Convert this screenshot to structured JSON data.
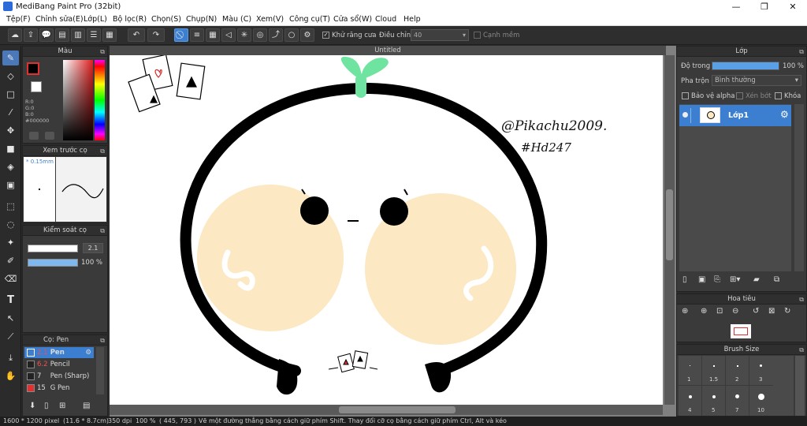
{
  "window": {
    "title": "MediBang Paint Pro (32bit)",
    "minimize": "—",
    "restore": "❐",
    "close": "✕"
  },
  "menu": [
    "Tệp(F)",
    "Chỉnh sửa(E)",
    "Lớp(L)",
    "Bộ lọc(R)",
    "Chọn(S)",
    "Chụp(N)",
    "Màu (C)",
    "Xem(V)",
    "Công cụ(T)",
    "Cửa sổ(W)",
    "Cloud",
    "Help"
  ],
  "toolbar": {
    "antialias_label": "Khử răng cưa",
    "adjust_label": "Điều chỉnh",
    "adjust_value": "40",
    "edge_label": "Cạnh mềm"
  },
  "document": {
    "tab_title": "Untitled",
    "signature_line1": "@Pikachu2009.",
    "signature_line2": "#Hd247"
  },
  "color_panel": {
    "title": "Màu",
    "r": "R:0",
    "g": "G:0",
    "b": "B:0",
    "hex": "#000000",
    "current_color": "#000000"
  },
  "preview_panel": {
    "title": "Xem trước cọ",
    "size": "* 0.15mm"
  },
  "brush_control": {
    "title": "Kiểm soát cọ",
    "size_value": "2.1",
    "opacity_value": "100 %",
    "opacity_level": 1.0
  },
  "brush_list": {
    "title": "Cọ: Pen",
    "items": [
      {
        "num": "2.1",
        "name": "Pen",
        "color": "#ffffff",
        "selected": true
      },
      {
        "num": "6.2",
        "name": "Pencil",
        "color": "#222222",
        "selected": false
      },
      {
        "num": "7",
        "name": "Pen (Sharp)",
        "color": "#222222",
        "selected": false
      },
      {
        "num": "15",
        "name": "G Pen",
        "color": "#e03030",
        "selected": false
      }
    ]
  },
  "layer_panel": {
    "title": "Lớp",
    "opacity_label": "Độ trong",
    "opacity_value": "100 %",
    "opacity_level": 1.0,
    "blend_label": "Pha trộn",
    "blend_value": "Bình thường",
    "alpha_protect": "Bảo vệ alpha",
    "clipping": "Xén bớt",
    "lock": "Khóa",
    "layers": [
      {
        "name": "Lớp1"
      }
    ]
  },
  "navigator": {
    "title": "Hoa tiêu"
  },
  "brush_size": {
    "title": "Brush Size",
    "values": [
      "1",
      "1.5",
      "2",
      "3",
      "4",
      "5",
      "7",
      "10"
    ]
  },
  "status": {
    "dimensions": "1600 * 1200 pixel",
    "physical": "(11.6 * 8.7cm)",
    "dpi": "350 dpi",
    "zoom": "100 %",
    "coords": "( 445, 793 )",
    "hint": "Vẽ một đường thẳng bằng cách giữ phím Shift. Thay đổi cỡ cọ bằng cách giữ phím Ctrl, Alt và kéo"
  },
  "colors": {
    "accent": "#3c7fd0",
    "cheek": "#fce8c2",
    "sprout": "#6fe3a0"
  }
}
